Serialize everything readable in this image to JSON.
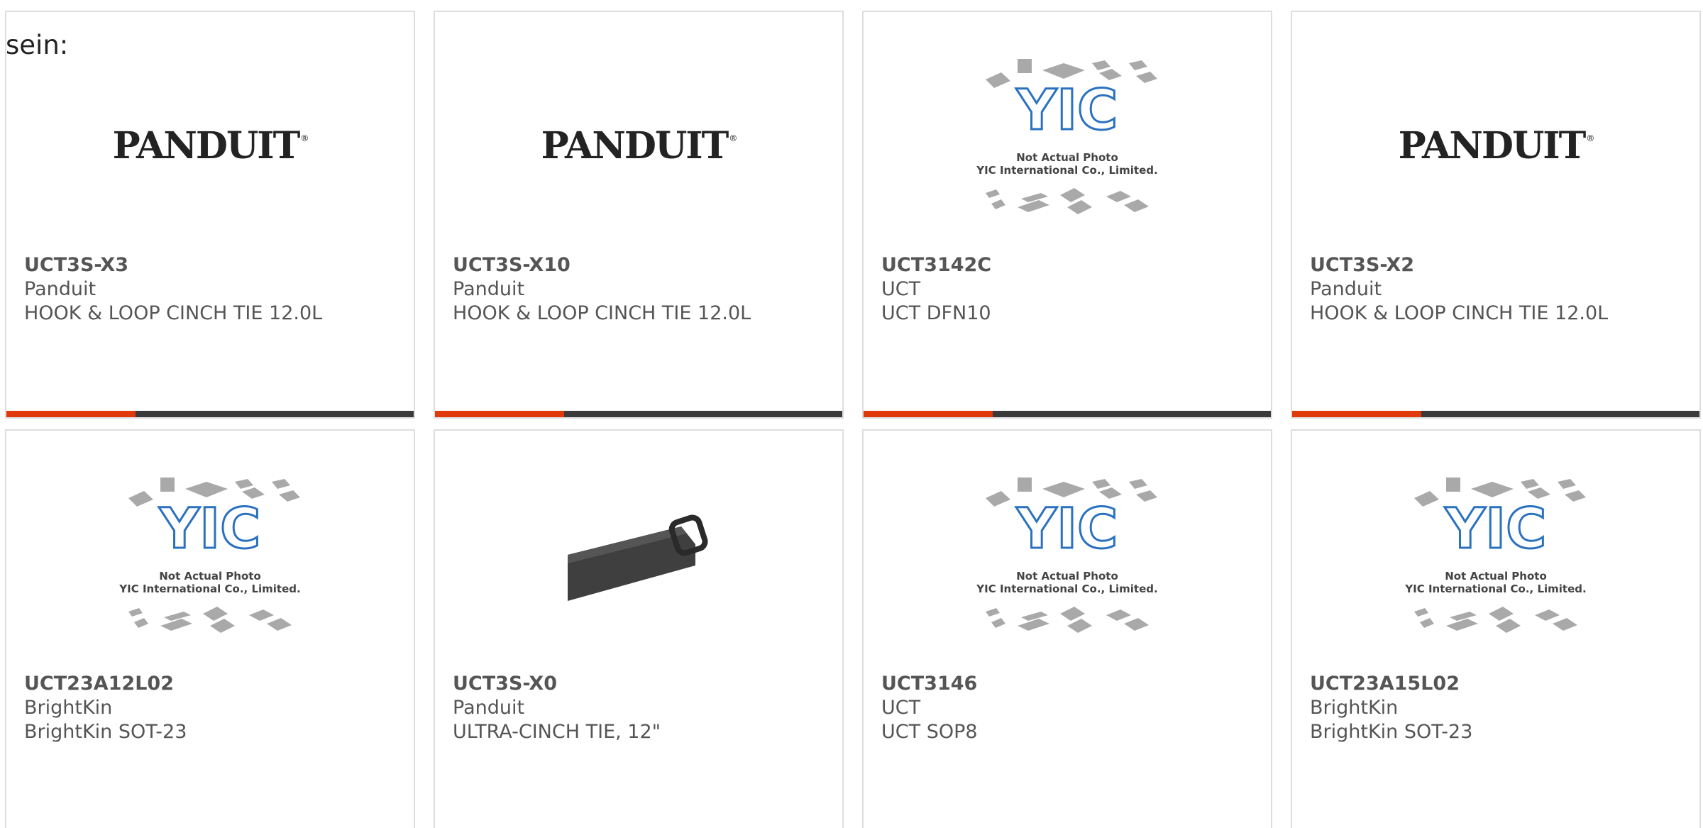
{
  "leading_text": "sein:",
  "colors": {
    "accent": "#e03a0a",
    "bar": "#3a3a3a",
    "border": "#dedede",
    "text": "#555555",
    "yic_blue": "#2a72c0"
  },
  "placeholder_image": {
    "line1": "Not Actual Photo",
    "line2": "YIC International Co., Limited."
  },
  "brand_logo": {
    "text": "PANDUIT",
    "mark": "®"
  },
  "products": [
    {
      "part": "UCT3S-X3",
      "maker": "Panduit",
      "desc": "HOOK & LOOP CINCH TIE 12.0L",
      "image": "panduit-logo"
    },
    {
      "part": "UCT3S-X10",
      "maker": "Panduit",
      "desc": "HOOK & LOOP CINCH TIE 12.0L",
      "image": "panduit-logo"
    },
    {
      "part": "UCT3142C",
      "maker": "UCT",
      "desc": "UCT DFN10",
      "image": "yic-placeholder"
    },
    {
      "part": "UCT3S-X2",
      "maker": "Panduit",
      "desc": "HOOK & LOOP CINCH TIE 12.0L",
      "image": "panduit-logo"
    },
    {
      "part": "UCT23A12L02",
      "maker": "BrightKin",
      "desc": "BrightKin SOT-23",
      "image": "yic-placeholder"
    },
    {
      "part": "UCT3S-X0",
      "maker": "Panduit",
      "desc": "ULTRA-CINCH TIE, 12\"",
      "image": "cinch-strap-photo"
    },
    {
      "part": "UCT3146",
      "maker": "UCT",
      "desc": "UCT SOP8",
      "image": "yic-placeholder"
    },
    {
      "part": "UCT23A15L02",
      "maker": "BrightKin",
      "desc": "BrightKin SOT-23",
      "image": "yic-placeholder"
    }
  ]
}
